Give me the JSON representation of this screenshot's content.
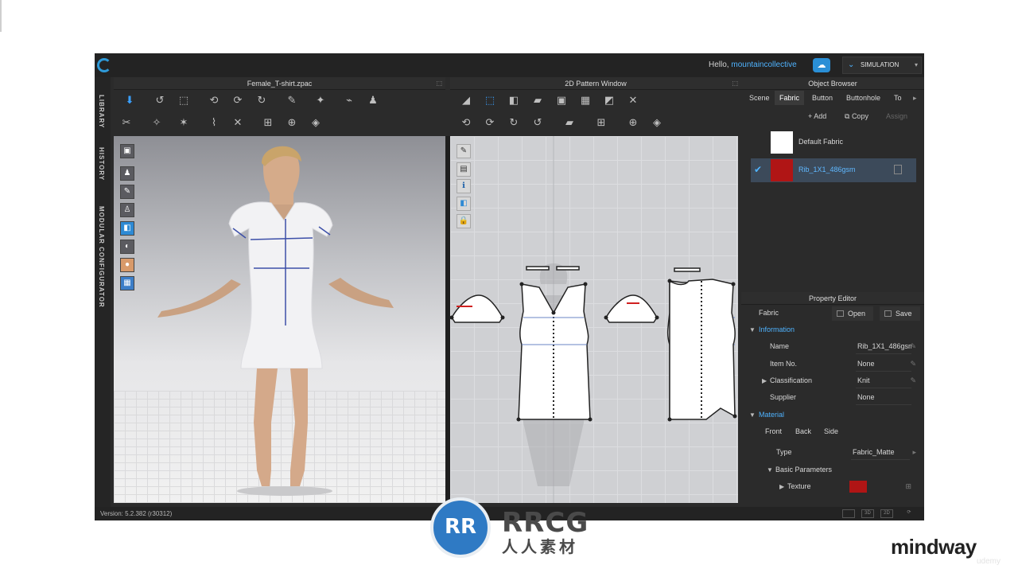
{
  "app": {
    "greeting": "Hello,",
    "username": "mountaincollective",
    "mode_button": "SIMULATION",
    "accent": "#4fb3ff"
  },
  "left_tabs": [
    "LIBRARY",
    "HISTORY",
    "MODULAR CONFIGURATOR"
  ],
  "panels": {
    "view3d_title": "Female_T-shirt.zpac",
    "view2d_title": "2D Pattern Window",
    "object_browser_title": "Object Browser",
    "property_editor_title": "Property Editor"
  },
  "object_browser": {
    "tabs": [
      "Scene",
      "Fabric",
      "Button",
      "Buttonhole",
      "To"
    ],
    "active_tab": "Fabric",
    "actions": {
      "add": "Add",
      "copy": "Copy",
      "assign": "Assign"
    },
    "fabrics": [
      {
        "name": "Default Fabric",
        "color": "#ffffff",
        "selected": false
      },
      {
        "name": "Rib_1X1_486gsm",
        "color": "#b01515",
        "selected": true
      }
    ]
  },
  "property_editor": {
    "object_label": "Fabric",
    "open_label": "Open",
    "save_label": "Save",
    "information_label": "Information",
    "fields": [
      {
        "label": "Name",
        "value": "Rib_1X1_486gsm"
      },
      {
        "label": "Item No.",
        "value": "None"
      },
      {
        "label": "Classification",
        "value": "Knit"
      },
      {
        "label": "Supplier",
        "value": "None"
      }
    ],
    "material_label": "Material",
    "material_tabs": [
      "Front",
      "Back",
      "Side"
    ],
    "type_label": "Type",
    "type_value": "Fabric_Matte",
    "basic_parameters_label": "Basic Parameters",
    "texture_label": "Texture",
    "texture_color": "#b01515"
  },
  "status": {
    "version": "Version: 5.2.382 (r30312)",
    "view_buttons": [
      "",
      "3D",
      "2D",
      ""
    ]
  },
  "watermark": {
    "logo_letters": "RR",
    "line1": "RRCG",
    "line2": "人人素材"
  },
  "brand": {
    "name": "mindway",
    "platform": "udemy"
  }
}
